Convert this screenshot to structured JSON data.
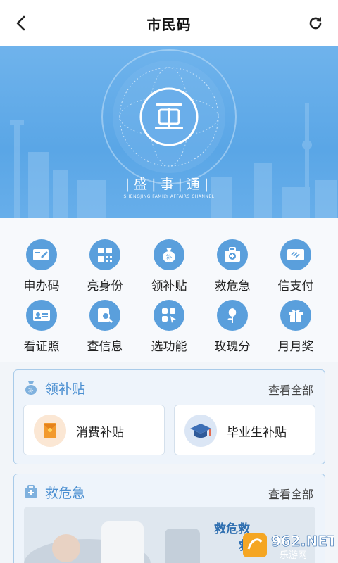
{
  "header": {
    "title": "市民码",
    "back_icon": "chevron-left-icon",
    "refresh_icon": "refresh-icon"
  },
  "banner": {
    "brand_cn": "|盛|事|通|",
    "brand_en": "SHENGJING FAMILY AFFAIRS CHANNEL"
  },
  "services": [
    {
      "label": "申办码",
      "icon": "card-edit-icon"
    },
    {
      "label": "亮身份",
      "icon": "qrcode-icon"
    },
    {
      "label": "领补贴",
      "icon": "money-bag-icon"
    },
    {
      "label": "救危急",
      "icon": "first-aid-kit-icon"
    },
    {
      "label": "信支付",
      "icon": "credit-card-icon"
    },
    {
      "label": "看证照",
      "icon": "id-card-icon"
    },
    {
      "label": "查信息",
      "icon": "search-doc-icon"
    },
    {
      "label": "选功能",
      "icon": "grid-apps-icon"
    },
    {
      "label": "玫瑰分",
      "icon": "rose-icon"
    },
    {
      "label": "月月奖",
      "icon": "gift-icon"
    }
  ],
  "subsidy_card": {
    "title": "领补贴",
    "more": "查看全部",
    "items": [
      {
        "label": "消费补贴",
        "icon": "red-envelope-icon"
      },
      {
        "label": "毕业生补贴",
        "icon": "graduation-cap-icon"
      }
    ]
  },
  "rescue_card": {
    "title": "救危急",
    "more": "查看全部",
    "image_text_1": "救危救",
    "image_text_2": "救"
  },
  "watermark": {
    "brand": "962.NET",
    "sub": "乐游网"
  },
  "colors": {
    "accent": "#5a9fdc",
    "card_title": "#4b8fd1",
    "banner": "#5fa8e8"
  }
}
